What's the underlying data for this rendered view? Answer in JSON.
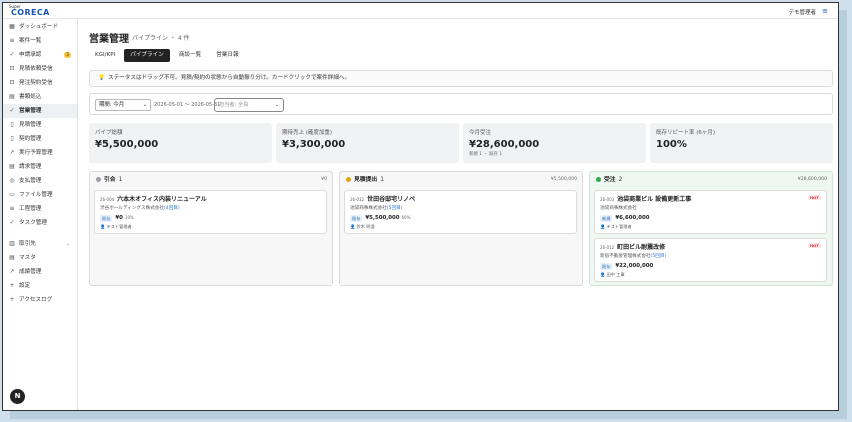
{
  "app": {
    "logo_small": "Super",
    "logo_main": "CORECA",
    "user_name": "デモ管理者",
    "user_icon": "user-menu-icon"
  },
  "sidebar": {
    "items": [
      {
        "icon": "grid-icon",
        "glyph": "▦",
        "label": "ダッシュボード"
      },
      {
        "icon": "list-icon",
        "glyph": "≡",
        "label": "案件一覧"
      },
      {
        "icon": "check-icon",
        "glyph": "✓",
        "label": "申請承認",
        "badge": "3"
      },
      {
        "icon": "inbox-icon",
        "glyph": "⊡",
        "label": "見積依頼受信"
      },
      {
        "icon": "inbox-icon",
        "glyph": "⊡",
        "label": "発注契約受信"
      },
      {
        "icon": "doc-icon",
        "glyph": "▤",
        "label": "書類処込"
      },
      {
        "icon": "check-icon",
        "glyph": "✓",
        "label": "営業管理",
        "active": true
      },
      {
        "icon": "file-icon",
        "glyph": "▯",
        "label": "見積管理"
      },
      {
        "icon": "file-icon",
        "glyph": "▯",
        "label": "契約管理"
      },
      {
        "icon": "trend-icon",
        "glyph": "↗",
        "label": "実行予算管理"
      },
      {
        "icon": "file-icon",
        "glyph": "▤",
        "label": "請求管理"
      },
      {
        "icon": "pay-icon",
        "glyph": "◎",
        "label": "支払管理"
      },
      {
        "icon": "folder-icon",
        "glyph": "▭",
        "label": "ファイル管理"
      },
      {
        "icon": "list-icon",
        "glyph": "≡",
        "label": "工程管理"
      },
      {
        "icon": "check-icon",
        "glyph": "✓",
        "label": "タスク管理"
      }
    ],
    "items2": [
      {
        "icon": "building-icon",
        "glyph": "▥",
        "label": "取引先",
        "chevron": "⌄"
      },
      {
        "icon": "database-icon",
        "glyph": "▤",
        "label": "マスタ"
      },
      {
        "icon": "chart-icon",
        "glyph": "↗",
        "label": "成績管理"
      },
      {
        "icon": "plus-icon",
        "glyph": "+",
        "label": "設定"
      },
      {
        "icon": "plus-icon",
        "glyph": "+",
        "label": "アクセスログ"
      }
    ],
    "bottom_badge": "N"
  },
  "page": {
    "title": "営業管理",
    "subtitle": "パイプライン ・ 4 件"
  },
  "tabs": [
    {
      "label": "KGI/KPI"
    },
    {
      "label": "パイプライン",
      "active": true
    },
    {
      "label": "商談一覧"
    },
    {
      "label": "営業日報"
    }
  ],
  "notice": "ステータスはドラッグ不可。見積/契約の状態から自動振り分け。カードクリックで案件詳細へ。",
  "filters": {
    "period": "期間: 今月",
    "date_range": "2026-05-01 〜 2026-05-31",
    "owner_placeholder": "担当者: 全員"
  },
  "kpis": [
    {
      "label": "パイプ総額",
      "value": "¥5,500,000",
      "sub": ""
    },
    {
      "label": "期待売上 (確度加重)",
      "value": "¥3,300,000",
      "sub": ""
    },
    {
      "label": "今月受注",
      "value": "¥28,600,000",
      "sub": "新規 1 ・ 既存 1"
    },
    {
      "label": "既存リピート率 (6ヶ月)",
      "value": "100%",
      "sub": ""
    }
  ],
  "columns": [
    {
      "name": "引合",
      "count": "1",
      "total": "¥0",
      "dot_color": "#9aa0a6",
      "cards": [
        {
          "code": "26-004",
          "title": "六本木オフィス内装リニューアル",
          "client": "渋谷ホールディングス株式会社",
          "note": "(4回目)",
          "stage": "既存",
          "amount": "¥0",
          "pct": "10%",
          "owner": "テスト管理者"
        }
      ]
    },
    {
      "name": "見積提出",
      "count": "1",
      "total": "¥5,500,000",
      "dot_color": "#e2a400",
      "cards": [
        {
          "code": "26-012",
          "title": "世田谷邸宅リノベ",
          "client": "池袋商事株式会社",
          "note": "(5回目)",
          "stage": "既存",
          "amount": "¥5,500,000",
          "pct": "60%",
          "owner": "鈴木 明澄"
        }
      ]
    },
    {
      "name": "受注",
      "count": "2",
      "total": "¥28,600,000",
      "dot_color": "#34a853",
      "cards": [
        {
          "code": "26-003",
          "title": "池袋商業ビル 設備更新工事",
          "client": "池袋商事株式会社",
          "note": "",
          "stage": "新規",
          "amount": "¥6,600,000",
          "pct": "",
          "owner": "テスト管理者",
          "hot": "HOT"
        },
        {
          "code": "26-012",
          "title": "町田ビル耐震改修",
          "client": "新宿不動産管理株式会社",
          "note": "(5回目)",
          "stage": "既存",
          "amount": "¥22,000,000",
          "pct": "",
          "owner": "田中 工事",
          "hot": "HOT"
        }
      ]
    }
  ]
}
